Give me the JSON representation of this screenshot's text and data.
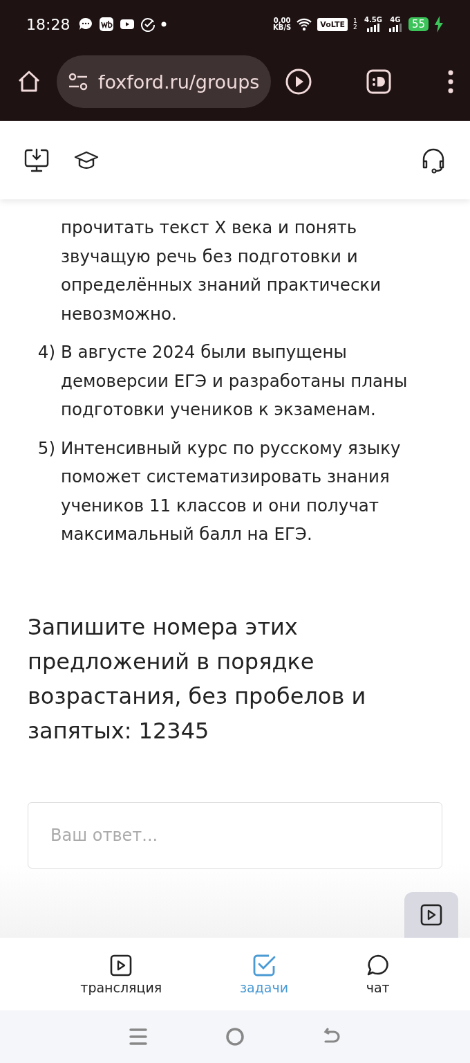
{
  "status_bar": {
    "time": "18:28",
    "speed": "0,00",
    "speed_unit": "KB/S",
    "volte": "VoLTE",
    "sims": "1 2",
    "net1": "4.5G",
    "net2": "4G",
    "battery": "55"
  },
  "browser": {
    "url": "foxford.ru/groups"
  },
  "items": [
    {
      "text": "прочитать текст Х века и понять звучащую речь без подготовки и определённых знаний практически невозможно."
    },
    {
      "number": "4)",
      "text": "В августе 2024 были выпущены демоверсии ЕГЭ и разработаны планы подготовки учеников к экзаменам."
    },
    {
      "number": "5)",
      "text": "Интенсивный курс по русскому языку поможет систематизировать знания учеников 11 классов и они получат максимальный балл на ЕГЭ."
    }
  ],
  "question": "Запишите номера этих предложений в порядке возрастания, без пробелов и запятых: 12345",
  "answer": {
    "placeholder": "Ваш ответ..."
  },
  "tabs": [
    {
      "label": "трансляция",
      "kind": "video",
      "selected": false
    },
    {
      "label": "задачи",
      "kind": "tasks",
      "selected": true
    },
    {
      "label": "чат",
      "kind": "chat",
      "selected": false
    }
  ]
}
